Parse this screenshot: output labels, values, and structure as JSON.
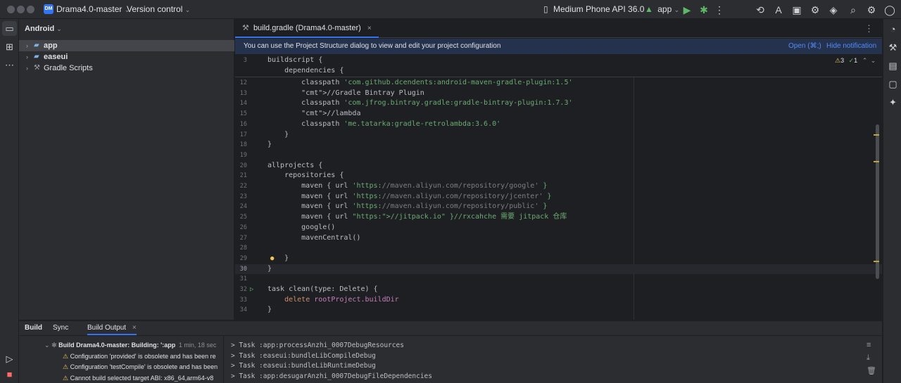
{
  "titlebar": {
    "project_name": "Drama4.0-master",
    "project_badge": "DM",
    "version_control": "Version control",
    "device": "Medium Phone API 36.0",
    "run_config": "app"
  },
  "project_panel": {
    "view_mode": "Android",
    "items": [
      {
        "label": "app",
        "selected": true
      },
      {
        "label": "easeui",
        "selected": false
      },
      {
        "label": "Gradle Scripts",
        "selected": false
      }
    ]
  },
  "editor": {
    "tab_label": "build.gradle (Drama4.0-master)",
    "notification": {
      "message": "You can use the Project Structure dialog to view and edit your project configuration",
      "open_label": "Open (⌘;)",
      "hide_label": "Hide notification"
    },
    "inspections": {
      "warnings": "3",
      "weak": "1"
    },
    "lines": [
      {
        "n": "3",
        "text": "buildscript {"
      },
      {
        "n": "",
        "text": "    dependencies {"
      },
      {
        "n": "12",
        "text": "        classpath 'com.github.dcendents:android-maven-gradle-plugin:1.5'"
      },
      {
        "n": "13",
        "text": "        //Gradle Bintray Plugin"
      },
      {
        "n": "14",
        "text": "        classpath 'com.jfrog.bintray.gradle:gradle-bintray-plugin:1.7.3'"
      },
      {
        "n": "15",
        "text": "        //lambda"
      },
      {
        "n": "16",
        "text": "        classpath 'me.tatarka:gradle-retrolambda:3.6.0'"
      },
      {
        "n": "17",
        "text": "    }"
      },
      {
        "n": "18",
        "text": "}"
      },
      {
        "n": "19",
        "text": ""
      },
      {
        "n": "20",
        "text": "allprojects {"
      },
      {
        "n": "21",
        "text": "    repositories {"
      },
      {
        "n": "22",
        "text": "        maven { url 'https://maven.aliyun.com/repository/google' }"
      },
      {
        "n": "23",
        "text": "        maven { url 'https://maven.aliyun.com/repository/jcenter' }"
      },
      {
        "n": "24",
        "text": "        maven { url 'https://maven.aliyun.com/repository/public' }"
      },
      {
        "n": "25",
        "text": "        maven { url \"https://jitpack.io\" }//rxcahche 需要 jitpack 仓库"
      },
      {
        "n": "26",
        "text": "        google()"
      },
      {
        "n": "27",
        "text": "        mavenCentral()"
      },
      {
        "n": "28",
        "text": ""
      },
      {
        "n": "29",
        "text": "    }"
      },
      {
        "n": "30",
        "text": "}"
      },
      {
        "n": "31",
        "text": ""
      },
      {
        "n": "32",
        "text": "task clean(type: Delete) {"
      },
      {
        "n": "33",
        "text": "    delete rootProject.buildDir"
      },
      {
        "n": "34",
        "text": "}"
      }
    ]
  },
  "bottom_panel": {
    "tabs": [
      "Build",
      "Sync",
      "Build Output"
    ],
    "build_tree": [
      {
        "text": "Build Drama4.0-master: Building: ':app",
        "time": "1 min, 18 sec"
      },
      {
        "text": "Configuration 'provided' is obsolete and has been re"
      },
      {
        "text": "Configuration 'testCompile' is obsolete and has been"
      },
      {
        "text": "Cannot build selected target ABI: x86_64,arm64-v8"
      }
    ],
    "output": [
      "> Task :app:processAnzhi_0007DebugResources",
      "> Task :easeui:bundleLibCompileDebug",
      "> Task :easeui:bundleLibRuntimeDebug",
      "> Task :app:desugarAnzhi_0007DebugFileDependencies"
    ]
  },
  "colors": {
    "accent": "#3574f0",
    "warning": "#f2c55c",
    "success": "#5fb865",
    "string": "#6aab73",
    "keyword": "#cf8e6d"
  }
}
